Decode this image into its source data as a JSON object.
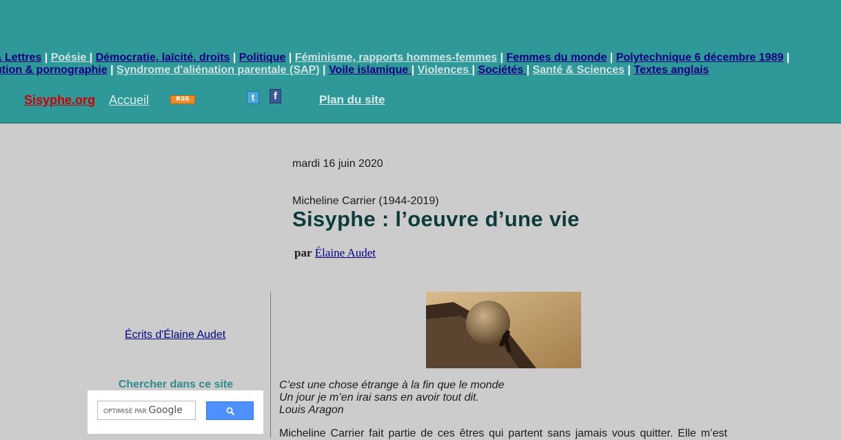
{
  "header": {
    "nav_line_1": [
      {
        "label": "& Lettres",
        "style": "dark"
      },
      {
        "label": "Poésie ",
        "style": "light"
      },
      {
        "label": "Démocratie, laïcité, droits",
        "style": "dark"
      },
      {
        "label": "Politique",
        "style": "dark"
      },
      {
        "label": "Féminisme, rapports hommes-femmes",
        "style": "light"
      },
      {
        "label": "Femmes du monde",
        "style": "dark"
      },
      {
        "label": "Polytechnique 6 décembre 1989",
        "style": "dark"
      }
    ],
    "nav_line_2": [
      {
        "label": "ution & pornographie",
        "style": "dark"
      },
      {
        "label": "Syndrome d'aliénation parentale (SAP)",
        "style": "light"
      },
      {
        "label": "Voile islamique ",
        "style": "dark"
      },
      {
        "label": "Violences ",
        "style": "light"
      },
      {
        "label": "Sociétés ",
        "style": "dark"
      },
      {
        "label": "Santé & Sciences",
        "style": "light"
      },
      {
        "label": "Textes anglais",
        "style": "dark"
      }
    ],
    "separator": "|",
    "site_name": "Sisyphe.org",
    "home_label": "Accueil",
    "rss_label": "RSS",
    "twitter_glyph": "t",
    "facebook_glyph": "f",
    "sitemap_label": "Plan du site"
  },
  "article": {
    "date": "mardi 16 juin 2020",
    "author_line": "Micheline Carrier (1944-2019)",
    "title": "Sisyphe : l’oeuvre d’une vie",
    "byline_prefix": "par",
    "byline_author": "Élaine Audet",
    "quote_lines": [
      "C’est une chose étrange à la fin que le monde",
      "Un jour je m’en irai sans en avoir tout dit.",
      "Louis Aragon"
    ],
    "body_start": "Micheline Carrier fait partie de ces êtres qui partent sans jamais vous quitter. Elle m’est"
  },
  "sidebar": {
    "writings_link": "Écrits d'Élaine Audet",
    "search_heading": "Chercher dans ce site",
    "search_placeholder_prefix": "OPTIMISÉ PAR ",
    "search_placeholder_brand": "Google"
  },
  "colors": {
    "header_bg": "#2f9999",
    "page_bg": "#cccccc",
    "nav_dark": "#000080",
    "nav_light": "#cfe3e3",
    "site_name": "#cc0000",
    "title": "#0d3b3b",
    "search_button": "#4d90fe"
  }
}
